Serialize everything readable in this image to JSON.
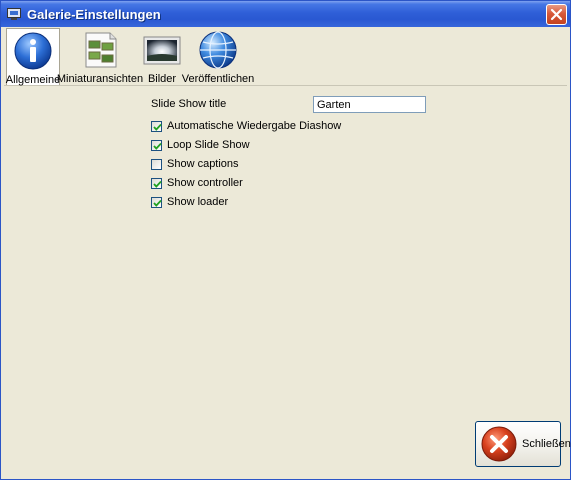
{
  "window": {
    "title": "Galerie-Einstellungen"
  },
  "toolbar": {
    "items": [
      {
        "label": "Allgemeine",
        "icon": "info-icon",
        "active": true
      },
      {
        "label": "Miniaturansichten",
        "icon": "thumbnails-icon",
        "active": false
      },
      {
        "label": "Bilder",
        "icon": "picture-icon",
        "active": false
      },
      {
        "label": "Veröffentlichen",
        "icon": "globe-icon",
        "active": false
      }
    ]
  },
  "settings": {
    "slide_show_title_label": "Slide Show title",
    "slide_show_title_value": "Garten",
    "options": [
      {
        "label": "Automatische Wiedergabe Diashow",
        "checked": true
      },
      {
        "label": "Loop Slide Show",
        "checked": true
      },
      {
        "label": "Show captions",
        "checked": false
      },
      {
        "label": "Show controller",
        "checked": true
      },
      {
        "label": "Show loader",
        "checked": true
      }
    ]
  },
  "footer": {
    "close_label": "Schließen"
  },
  "colors": {
    "titlebar": "#2f5fd8",
    "background": "#ece9d8",
    "close_red": "#c4431f",
    "checkmark": "#21a121"
  }
}
